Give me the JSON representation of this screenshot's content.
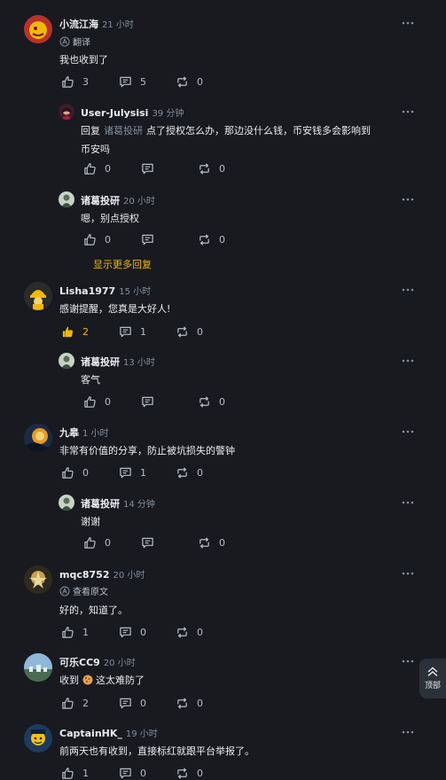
{
  "translate_label": "翻译",
  "view_original_label": "查看原文",
  "reply_prefix": "回复",
  "show_more_label": "显示更多回复",
  "to_top_label": "顶部",
  "comments": [
    {
      "name": "小流江海",
      "time": "21 小时",
      "text": "我也收到了",
      "likes": "3",
      "replies": "5",
      "reposts": "0"
    },
    {
      "name": "User-Julysisi",
      "time": "39 分钟",
      "reply_to": "诸葛投研",
      "text_line1": "点了授权怎么办，那边没什么钱，币安钱多会影响到",
      "text_line2": "币安吗",
      "likes": "0",
      "reposts": "0"
    },
    {
      "name": "诸葛投研",
      "time": "20 小时",
      "text": "嗯，别点授权",
      "likes": "0",
      "reposts": "0"
    },
    {
      "name": "Lisha1977",
      "time": "15 小时",
      "text": "感谢提醒，您真是大好人!",
      "likes": "2",
      "replies": "1",
      "reposts": "0"
    },
    {
      "name": "诸葛投研",
      "time": "13 小时",
      "text": "客气",
      "likes": "0",
      "reposts": "0"
    },
    {
      "name": "九皋",
      "time": "1 小时",
      "text": "非常有价值的分享，防止被坑损失的警钟",
      "likes": "0",
      "replies": "1",
      "reposts": "0"
    },
    {
      "name": "诸葛投研",
      "time": "14 分钟",
      "text": "谢谢",
      "likes": "0",
      "reposts": "0"
    },
    {
      "name": "mqc8752",
      "time": "20 小时",
      "text": "好的，知道了。",
      "likes": "1",
      "replies": "0",
      "reposts": "0"
    },
    {
      "name": "可乐CC9",
      "time": "20 小时",
      "text_a": "收到",
      "text_b": "这太难防了",
      "likes": "2",
      "replies": "0",
      "reposts": "0"
    },
    {
      "name": "CaptainHK_",
      "time": "19 小时",
      "text": "前两天也有收到，直接标红就跟平台举报了。",
      "likes": "1",
      "replies": "0",
      "reposts": "0"
    }
  ],
  "colors": {
    "background": "#181a20",
    "accent": "#f0b90b",
    "muted": "#848e9c",
    "text": "#eaecef"
  }
}
